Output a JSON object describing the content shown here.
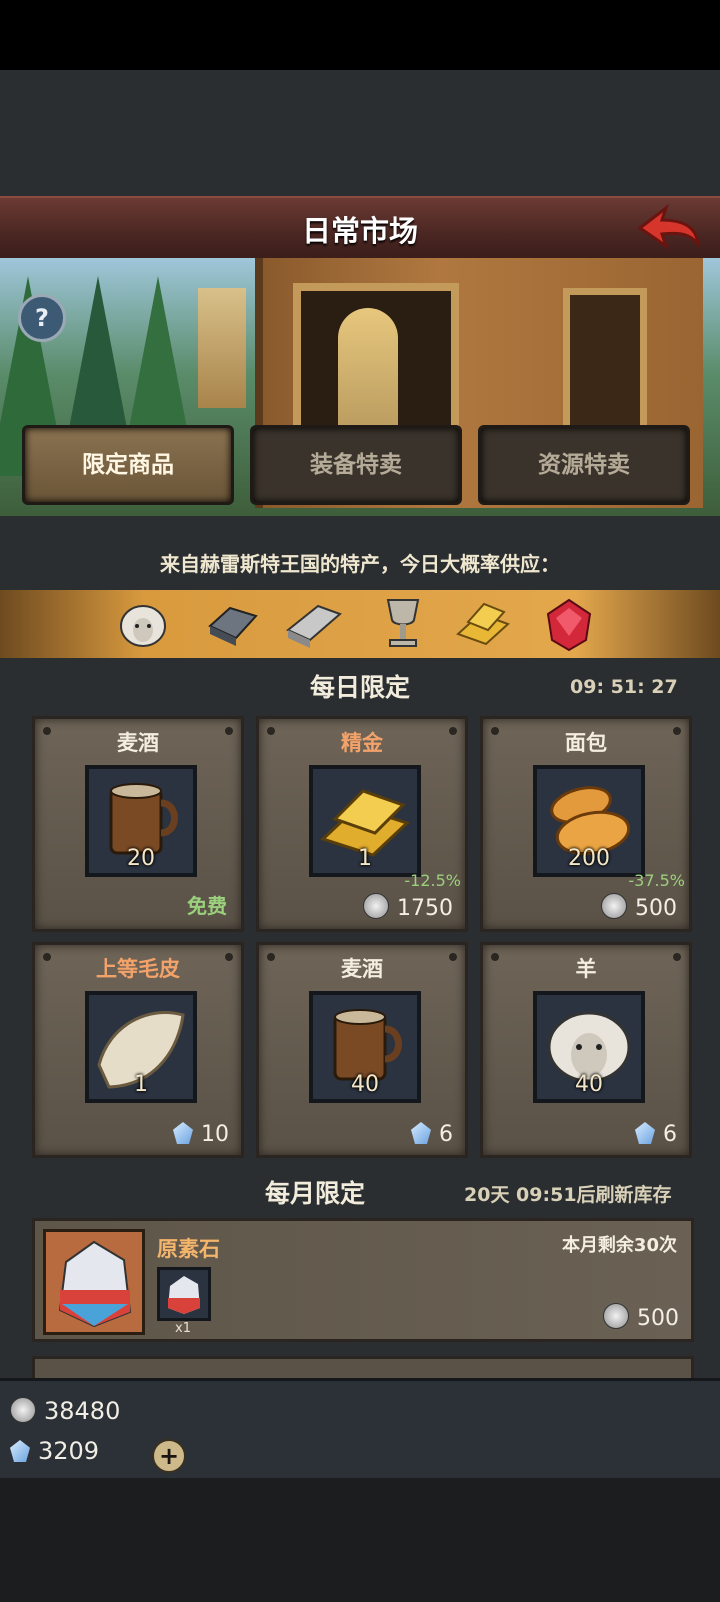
{
  "header": {
    "title": "日常市场"
  },
  "banner": {
    "help_label": "?"
  },
  "tabs": [
    "限定商品",
    "装备特卖",
    "资源特卖"
  ],
  "supply": {
    "title": "来自赫雷斯特王国的特产，今日大概率供应：",
    "items": [
      "sheep-icon",
      "iron-ingot-icon",
      "silver-ingot-icon",
      "goblet-icon",
      "gold-bars-icon",
      "ruby-icon"
    ]
  },
  "daily": {
    "title": "每日限定",
    "timer": "09: 51: 27",
    "items": [
      {
        "name": "麦酒",
        "qty": "20",
        "price_label": "免费",
        "icon": "mug-icon"
      },
      {
        "name": "精金",
        "qty": "1",
        "discount": "-12.5%",
        "price": "1750",
        "currency": "coin",
        "icon": "gold-bars-icon"
      },
      {
        "name": "面包",
        "qty": "200",
        "discount": "-37.5%",
        "price": "500",
        "currency": "coin",
        "icon": "bread-icon"
      },
      {
        "name": "上等毛皮",
        "qty": "1",
        "price": "10",
        "currency": "gem",
        "icon": "fur-icon"
      },
      {
        "name": "麦酒",
        "qty": "40",
        "price": "6",
        "currency": "gem",
        "icon": "mug-icon"
      },
      {
        "name": "羊",
        "qty": "40",
        "price": "6",
        "currency": "gem",
        "icon": "sheep-icon"
      }
    ]
  },
  "monthly": {
    "title": "每月限定",
    "refresh": "20天 09:51后刷新库存",
    "items": [
      {
        "name": "原素石",
        "remaining": "本月剩余30次",
        "mini_qty": "x1",
        "price": "500",
        "currency": "coin",
        "icon": "element-stone-icon"
      }
    ]
  },
  "resources": {
    "coins": "38480",
    "gems": "3209"
  }
}
